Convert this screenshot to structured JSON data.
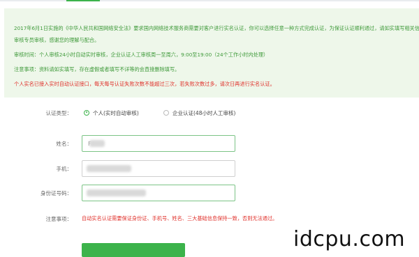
{
  "notice": {
    "line1": "2017年6月1日实施的《中华人民共和国网络安全法》要求国内网络技术服务商需要对客户进行实名认证，你可以选择任意一种方式完成认证，为保证认证顺利通过，请如实填写相关信息，我们会在审核专员审核后进行认证结果通知。",
    "line1b": "审核专员审核，感谢您的理解与配合。",
    "line2": "审核时间：个人审核24小时自动实时审核，企业认证人工审核周一至周六，9:00至19:00（24个工作小时内处理）",
    "line3": "注意事项：资料请如实填写，存在虚假或者填写不详等的会直接删除填写。",
    "warning": "个人实名已接入实时自动认证接口，每天每号认证失败次数不能超过三次，若失败次数过多，请次日再进行实名认证。"
  },
  "form": {
    "type_label": "认证类型：",
    "option_personal": "个人(实时自动审核)",
    "option_company": "企业认证(48小时人工审核)",
    "name_label": "姓名：",
    "name_value": "F",
    "phone_label": "手机：",
    "id_label": "身份证号码：",
    "notes_label": "注意事项：",
    "notes_text": "自动实名认证需要保证身份证、手机号、姓名、三大基础信息保持一致，否则无法通过。"
  },
  "watermark": "idcpu.com"
}
